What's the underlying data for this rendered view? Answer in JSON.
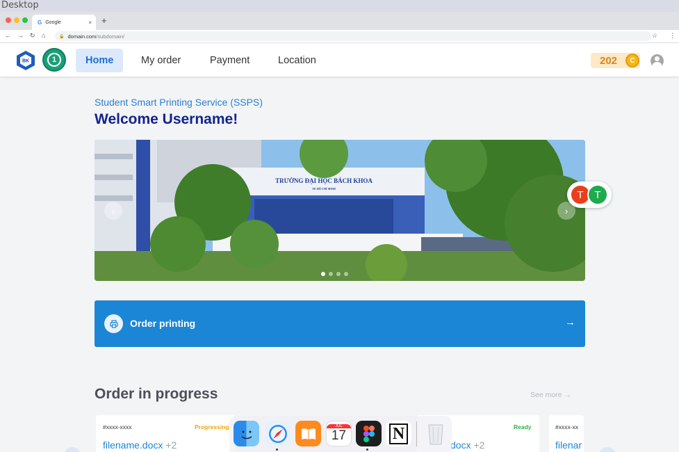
{
  "desktop": {
    "label": "Desktop"
  },
  "browser": {
    "tab_title": "Google",
    "tab_icon": "G",
    "close_glyph": "×",
    "new_tab_glyph": "+",
    "url_domain": "domain.com",
    "url_path": "/subdomain/"
  },
  "nav": {
    "items": [
      {
        "label": "Home",
        "active": true
      },
      {
        "label": "My order",
        "active": false
      },
      {
        "label": "Payment",
        "active": false
      },
      {
        "label": "Location",
        "active": false
      }
    ],
    "coins": "202",
    "coin_symbol": "C",
    "logo_text": "BK",
    "seal_text": "1"
  },
  "hero": {
    "subtitle": "Student Smart Printing Service (SSPS)",
    "welcome": "Welcome Username!",
    "building_sign": "TRƯỜNG ĐẠI HỌC BÁCH KHOA",
    "building_sign_sub": "TP. HỒ CHÍ MINH",
    "slide_count": 4,
    "active_slide": 1
  },
  "overlay_avatars": [
    {
      "initial": "T",
      "color": "#e8401c"
    },
    {
      "initial": "T",
      "color": "#1faa4f"
    }
  ],
  "order_button": {
    "label": "Order printing",
    "arrow": "→"
  },
  "orders": {
    "title": "Order in progress",
    "see_more": "See more →",
    "cards": [
      {
        "id": "#xxxx-xxxx",
        "status": "Progressing",
        "status_color": "#f0a500",
        "file": "filename.docx",
        "more": "+2"
      },
      {
        "id": "",
        "status": "Ready",
        "status_color": "#2bb34a",
        "file": "docx",
        "more": "+2"
      },
      {
        "id": "#xxxx-xx",
        "status": "",
        "status_color": "#2bb34a",
        "file": "filenar",
        "more": ""
      }
    ]
  },
  "dock": {
    "apps": [
      "Finder",
      "Safari",
      "Books",
      "Calendar",
      "Figma",
      "Notion",
      "Trash"
    ],
    "calendar_month": "JUL",
    "calendar_day": "17",
    "notion_glyph": "N"
  }
}
